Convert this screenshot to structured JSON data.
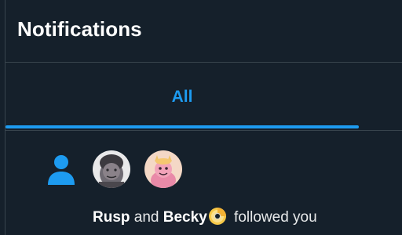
{
  "header": {
    "title": "Notifications"
  },
  "tabs": [
    {
      "label": "All",
      "active": true
    }
  ],
  "notification": {
    "type_icon": "person-icon",
    "avatars": [
      {
        "name": "Rusp"
      },
      {
        "name": "Becky"
      }
    ],
    "user1": "Rusp",
    "connector": "and",
    "user2": "Becky",
    "user2_badge_icon": "cd-disc-emoji-icon",
    "action": "followed you"
  },
  "colors": {
    "background": "#15202b",
    "accent": "#1d9bf0",
    "divider": "#38444d",
    "text": "#e7e9ea"
  }
}
